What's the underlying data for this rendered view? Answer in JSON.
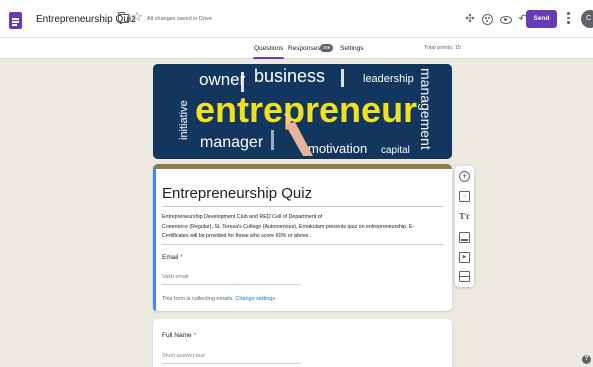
{
  "header": {
    "doc_title": "Entrepreneurship Quiz",
    "save_status": "All changes saved in Drive",
    "send_label": "Send",
    "avatar_initial": "C",
    "icons": [
      "forms-app-icon",
      "folder-icon",
      "star-icon",
      "puzzle-icon",
      "palette-icon",
      "eye-icon",
      "undo-icon",
      "redo-icon",
      "more-vert-icon"
    ]
  },
  "tabs": {
    "questions": "Questions",
    "responses": "Responses",
    "responses_count": "256",
    "settings": "Settings",
    "total_points": "Total points: 15"
  },
  "banner": {
    "words": [
      "owner",
      "business",
      "leadership",
      "entrepreneur",
      "initiative",
      "manager",
      "motivation",
      "capital",
      "management"
    ]
  },
  "form": {
    "title": "Entrepreneurship Quiz",
    "description": "Entrepreneurship Development Club and RED Cell of Department of\nCommerce (Regular), St. Teresa's College (Autonomous), Ernakulam presents quiz on entrepreneurship. E-\nCertificates will be provided for those who score 60% or above.",
    "email_label": "Email",
    "required_mark": "*",
    "email_placeholder": "Valid email",
    "collecting_note": "This form is collecting emails.",
    "change_settings": "Change settings"
  },
  "question2": {
    "label": "Full Name",
    "placeholder": "Short answer text"
  },
  "toolbar": {
    "title_glyph": "Tт"
  },
  "colors": {
    "accent": "#673ab7",
    "banner_bg": "#13365f",
    "banner_yellow": "#f2e21d",
    "header_strip": "#8b7b4d",
    "focus_blue": "#4285f4"
  }
}
